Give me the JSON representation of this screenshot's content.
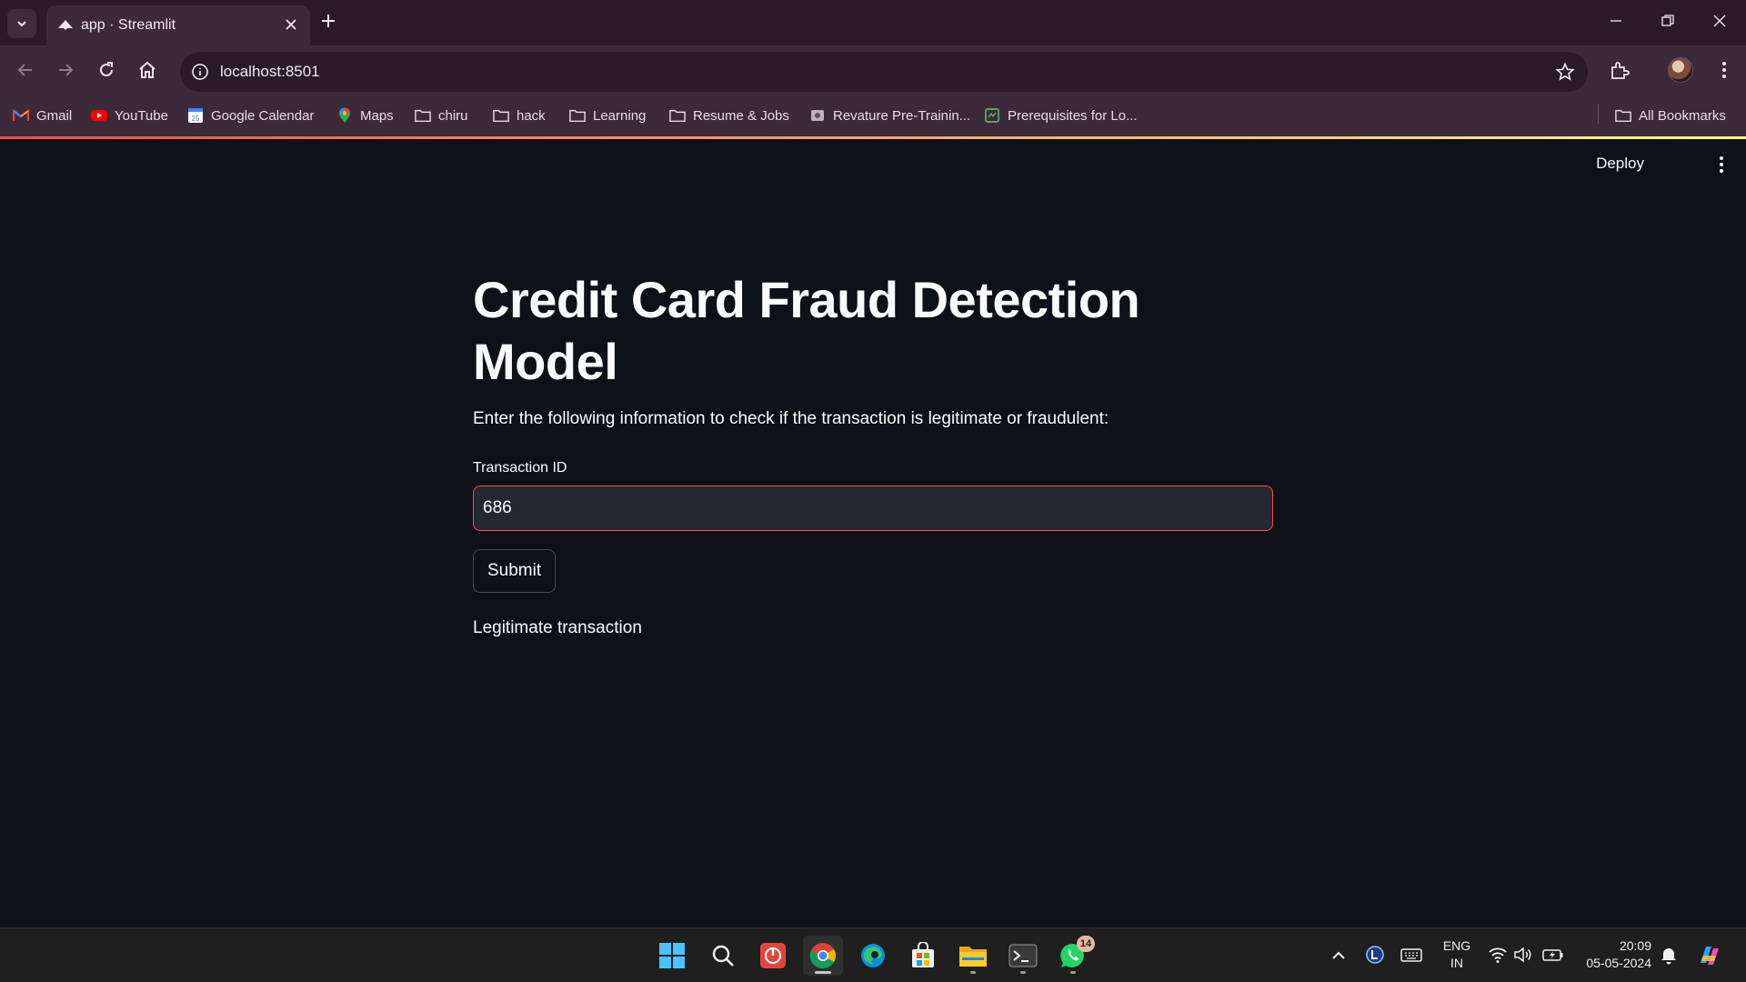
{
  "browser": {
    "tab_title": "app · Streamlit",
    "url": "localhost:8501",
    "bookmarks": [
      {
        "label": "Gmail",
        "icon": "gmail-icon"
      },
      {
        "label": "YouTube",
        "icon": "youtube-icon"
      },
      {
        "label": "Google Calendar",
        "icon": "calendar-icon"
      },
      {
        "label": "Maps",
        "icon": "maps-icon"
      },
      {
        "label": "chiru",
        "icon": "folder-icon"
      },
      {
        "label": "hack",
        "icon": "folder-icon"
      },
      {
        "label": "Learning",
        "icon": "folder-icon"
      },
      {
        "label": "Resume & Jobs",
        "icon": "folder-icon"
      },
      {
        "label": "Revature Pre-Trainin...",
        "icon": "revature-icon"
      },
      {
        "label": "Prerequisites for Lo...",
        "icon": "page-icon"
      }
    ],
    "all_bookmarks_label": "All Bookmarks"
  },
  "app": {
    "deploy_label": "Deploy",
    "title": "Credit Card Fraud Detection Model",
    "intro": "Enter the following information to check if the transaction is legitimate or fraudulent:",
    "field_label": "Transaction ID",
    "field_value": "686",
    "submit_label": "Submit",
    "result": "Legitimate transaction",
    "accent_color": "#ff4b4b",
    "background_color": "#0e1117"
  },
  "taskbar": {
    "apps": [
      "windows-start-icon",
      "search-icon",
      "power-app-icon",
      "chrome-icon",
      "edge-icon",
      "store-icon",
      "file-explorer-icon",
      "terminal-icon",
      "whatsapp-icon"
    ],
    "whatsapp_badge": "14",
    "language_line1": "ENG",
    "language_line2": "IN",
    "time": "20:09",
    "date": "05-05-2024"
  }
}
